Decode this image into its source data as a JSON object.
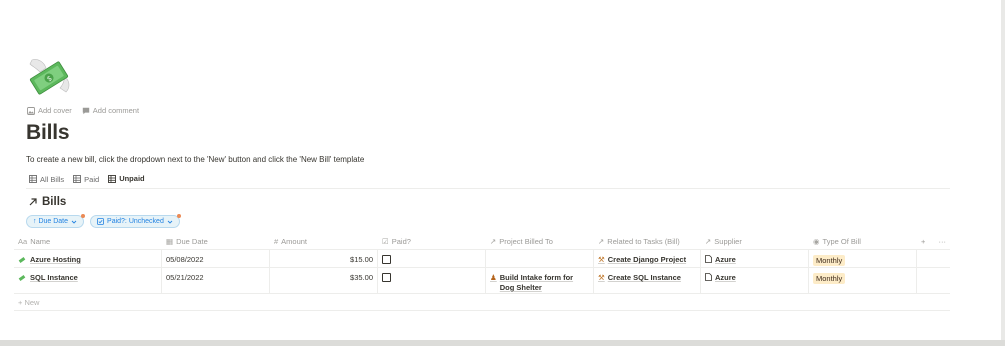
{
  "page": {
    "icon": "money-with-wings-icon",
    "add_cover": "Add cover",
    "add_comment": "Add comment",
    "title": "Bills",
    "description": "To create a new bill, click the dropdown next to the 'New' button and click the 'New Bill' template"
  },
  "views": [
    {
      "label": "All Bills",
      "icon": "table-icon",
      "active": false
    },
    {
      "label": "Paid",
      "icon": "table-icon",
      "active": false
    },
    {
      "label": "Unpaid",
      "icon": "table-icon",
      "active": true
    }
  ],
  "database": {
    "title": "Bills",
    "link_icon": "arrow-up-right-icon"
  },
  "filters": [
    {
      "label": "↑ Due Date",
      "icon": "chevron-down-icon"
    },
    {
      "label": "Paid?: Unchecked",
      "icon": "checkbox-icon"
    }
  ],
  "columns": {
    "name": "Name",
    "due": "Due Date",
    "amount": "Amount",
    "paid": "Paid?",
    "project": "Project Billed To",
    "task": "Related to Tasks (Bill)",
    "supplier": "Supplier",
    "type": "Type Of Bill",
    "add": "+",
    "more": "···"
  },
  "rows": [
    {
      "name": "Azure Hosting",
      "due": "05/08/2022",
      "amount": "$15.00",
      "paid": false,
      "project": "",
      "task": "Create Django Project",
      "supplier": "Azure",
      "type": "Monthly"
    },
    {
      "name": "SQL Instance",
      "due": "05/21/2022",
      "amount": "$35.00",
      "paid": false,
      "project": "Build Intake form for Dog Shelter",
      "task": "Create SQL Instance",
      "supplier": "Azure",
      "type": "Monthly"
    }
  ],
  "new_label": "+ New",
  "colors": {
    "accent": "#2383e2",
    "tag_bg": "#fdecc8",
    "filter_bg": "#e7f3f8"
  }
}
